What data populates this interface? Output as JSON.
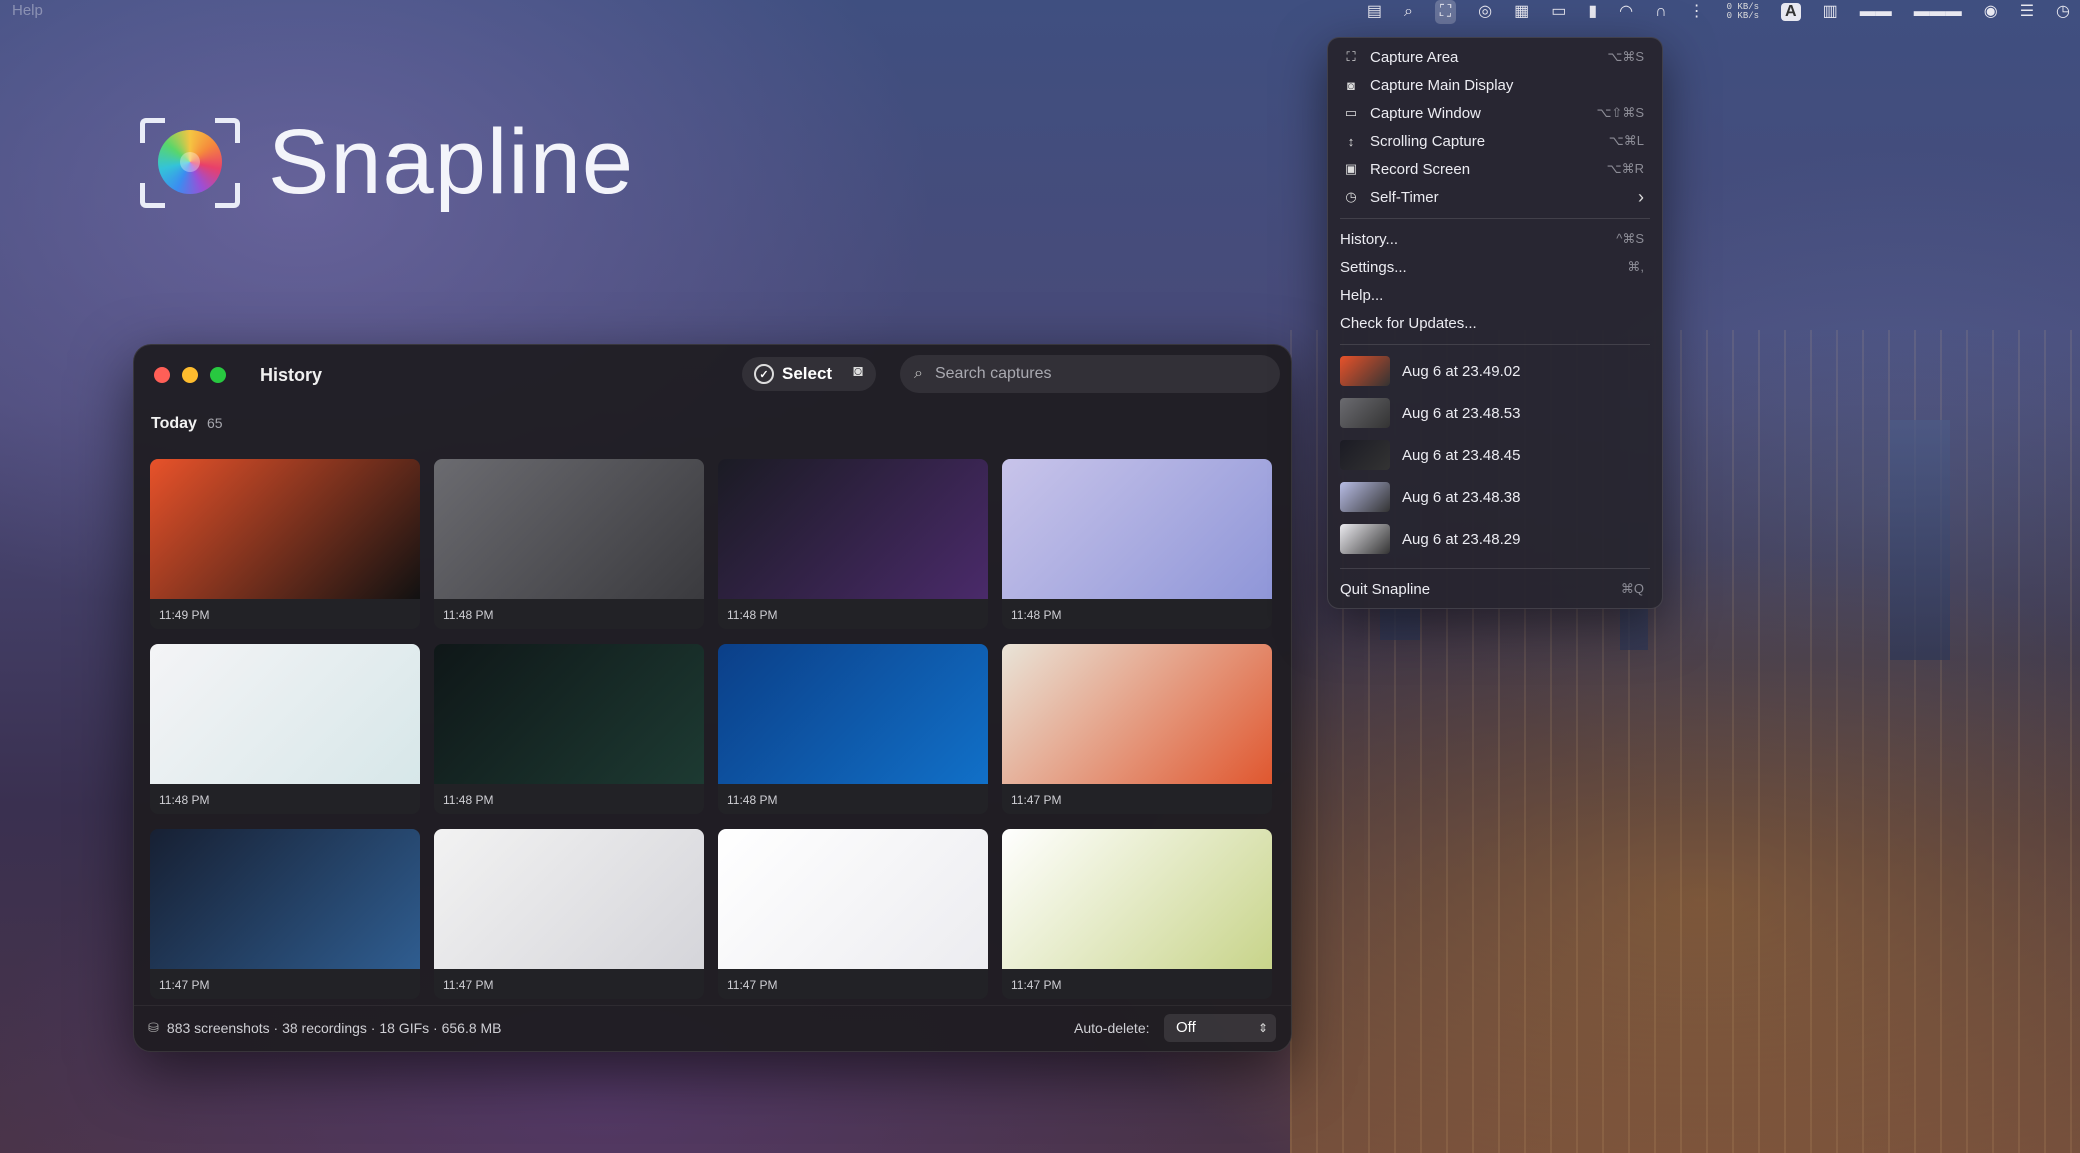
{
  "menubar": {
    "app_menu_help": "Help",
    "net_up": "0 KB/s",
    "net_down": "0 KB/s",
    "keyboard_badge": "A"
  },
  "brand": {
    "name": "Snapline"
  },
  "history": {
    "title": "History",
    "select_label": "Select",
    "search_placeholder": "Search captures",
    "section": {
      "title": "Today",
      "count": "65"
    },
    "items": [
      {
        "time": "11:49 PM",
        "colors": [
          "#e8522a",
          "#111111"
        ]
      },
      {
        "time": "11:48 PM",
        "colors": [
          "#6b6b70",
          "#3a3a3e"
        ]
      },
      {
        "time": "11:48 PM",
        "colors": [
          "#1b1b24",
          "#4a2a6a"
        ]
      },
      {
        "time": "11:48 PM",
        "colors": [
          "#c8c4ea",
          "#8f96d8"
        ]
      },
      {
        "time": "11:48 PM",
        "colors": [
          "#f4f4f6",
          "#d7e7e9"
        ]
      },
      {
        "time": "11:48 PM",
        "colors": [
          "#0f1718",
          "#1d3a32"
        ]
      },
      {
        "time": "11:48 PM",
        "colors": [
          "#0b3f88",
          "#1170c8"
        ]
      },
      {
        "time": "11:47 PM",
        "colors": [
          "#e9e4d8",
          "#e0572f"
        ]
      },
      {
        "time": "11:47 PM",
        "colors": [
          "#172033",
          "#2f5d90"
        ]
      },
      {
        "time": "11:47 PM",
        "colors": [
          "#f2f2f2",
          "#d5d5da"
        ]
      },
      {
        "time": "11:47 PM",
        "colors": [
          "#ffffff",
          "#ececf0"
        ]
      },
      {
        "time": "11:47 PM",
        "colors": [
          "#ffffff",
          "#c8d48a"
        ]
      }
    ],
    "footer": {
      "stats": "883 screenshots · 38 recordings · 18 GIFs · 656.8 MB",
      "auto_delete_label": "Auto-delete:",
      "auto_delete_value": "Off"
    }
  },
  "menu": {
    "capture_items": [
      {
        "label": "Capture Area",
        "shortcut": "⌥⌘S",
        "icon": "capture-area-icon"
      },
      {
        "label": "Capture Main Display",
        "shortcut": "",
        "icon": "camera-icon"
      },
      {
        "label": "Capture Window",
        "shortcut": "⌥⇧⌘S",
        "icon": "window-icon"
      },
      {
        "label": "Scrolling Capture",
        "shortcut": "⌥⌘L",
        "icon": "scroll-arrows-icon"
      },
      {
        "label": "Record Screen",
        "shortcut": "⌥⌘R",
        "icon": "video-icon"
      },
      {
        "label": "Self-Timer",
        "shortcut": "",
        "icon": "timer-icon"
      }
    ],
    "app_items": [
      {
        "label": "History...",
        "shortcut": "^⌘S"
      },
      {
        "label": "Settings...",
        "shortcut": "⌘,"
      },
      {
        "label": "Help...",
        "shortcut": ""
      },
      {
        "label": "Check for Updates...",
        "shortcut": ""
      }
    ],
    "recent": [
      {
        "label": "Aug 6 at 23.49.02",
        "color": "#e8522a"
      },
      {
        "label": "Aug 6 at 23.48.53",
        "color": "#6b6b70"
      },
      {
        "label": "Aug 6 at 23.48.45",
        "color": "#1b1b24"
      },
      {
        "label": "Aug 6 at 23.48.38",
        "color": "#b8bde6"
      },
      {
        "label": "Aug 6 at 23.48.29",
        "color": "#ecebf0"
      }
    ],
    "quit": {
      "label": "Quit Snapline",
      "shortcut": "⌘Q"
    }
  }
}
